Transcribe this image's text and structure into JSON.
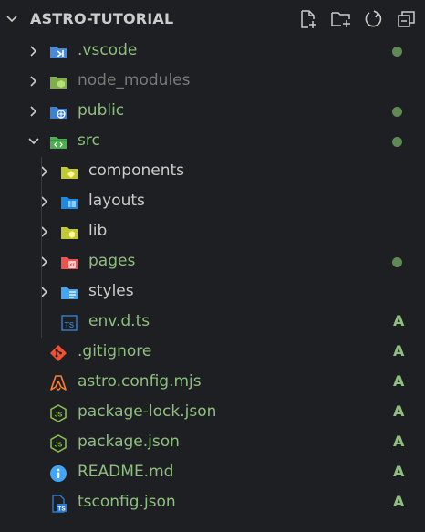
{
  "header": {
    "title": "ASTRO-TUTORIAL",
    "actions": [
      "new-file-icon",
      "new-folder-icon",
      "refresh-icon",
      "collapse-all-icon"
    ]
  },
  "colors": {
    "background": "#1e1f22",
    "text_default": "#cccccc",
    "text_modified": "#8fbf7f",
    "text_ignored": "#7a7a7a",
    "dot_modified": "#5f8a55",
    "status_added": "#8fbf7f"
  },
  "tree": [
    {
      "label": ".vscode",
      "icon": "vscode-folder-icon",
      "kind": "folder",
      "expanded": false,
      "depth": 0,
      "state": "modified",
      "decoration": "dot"
    },
    {
      "label": "node_modules",
      "icon": "node-folder-icon",
      "kind": "folder",
      "expanded": false,
      "depth": 0,
      "state": "ignored",
      "decoration": ""
    },
    {
      "label": "public",
      "icon": "public-folder-icon",
      "kind": "folder",
      "expanded": false,
      "depth": 0,
      "state": "modified",
      "decoration": "dot"
    },
    {
      "label": "src",
      "icon": "src-folder-icon",
      "kind": "folder",
      "expanded": true,
      "depth": 0,
      "state": "modified",
      "decoration": "dot"
    },
    {
      "label": "components",
      "icon": "components-folder-icon",
      "kind": "folder",
      "expanded": false,
      "depth": 1,
      "state": "default",
      "decoration": ""
    },
    {
      "label": "layouts",
      "icon": "layouts-folder-icon",
      "kind": "folder",
      "expanded": false,
      "depth": 1,
      "state": "default",
      "decoration": ""
    },
    {
      "label": "lib",
      "icon": "lib-folder-icon",
      "kind": "folder",
      "expanded": false,
      "depth": 1,
      "state": "default",
      "decoration": ""
    },
    {
      "label": "pages",
      "icon": "pages-folder-icon",
      "kind": "folder",
      "expanded": false,
      "depth": 1,
      "state": "modified",
      "decoration": "dot"
    },
    {
      "label": "styles",
      "icon": "styles-folder-icon",
      "kind": "folder",
      "expanded": false,
      "depth": 1,
      "state": "default",
      "decoration": ""
    },
    {
      "label": "env.d.ts",
      "icon": "typescript-icon",
      "kind": "file",
      "depth": 1,
      "state": "added",
      "decoration": "A"
    },
    {
      "label": ".gitignore",
      "icon": "git-icon",
      "kind": "file",
      "depth": 0,
      "state": "added",
      "decoration": "A"
    },
    {
      "label": "astro.config.mjs",
      "icon": "astro-icon",
      "kind": "file",
      "depth": 0,
      "state": "added",
      "decoration": "A"
    },
    {
      "label": "package-lock.json",
      "icon": "nodejs-icon",
      "kind": "file",
      "depth": 0,
      "state": "added",
      "decoration": "A"
    },
    {
      "label": "package.json",
      "icon": "nodejs-icon",
      "kind": "file",
      "depth": 0,
      "state": "added",
      "decoration": "A"
    },
    {
      "label": "README.md",
      "icon": "info-icon",
      "kind": "file",
      "depth": 0,
      "state": "added",
      "decoration": "A"
    },
    {
      "label": "tsconfig.json",
      "icon": "tsconfig-icon",
      "kind": "file",
      "depth": 0,
      "state": "added",
      "decoration": "A"
    }
  ]
}
